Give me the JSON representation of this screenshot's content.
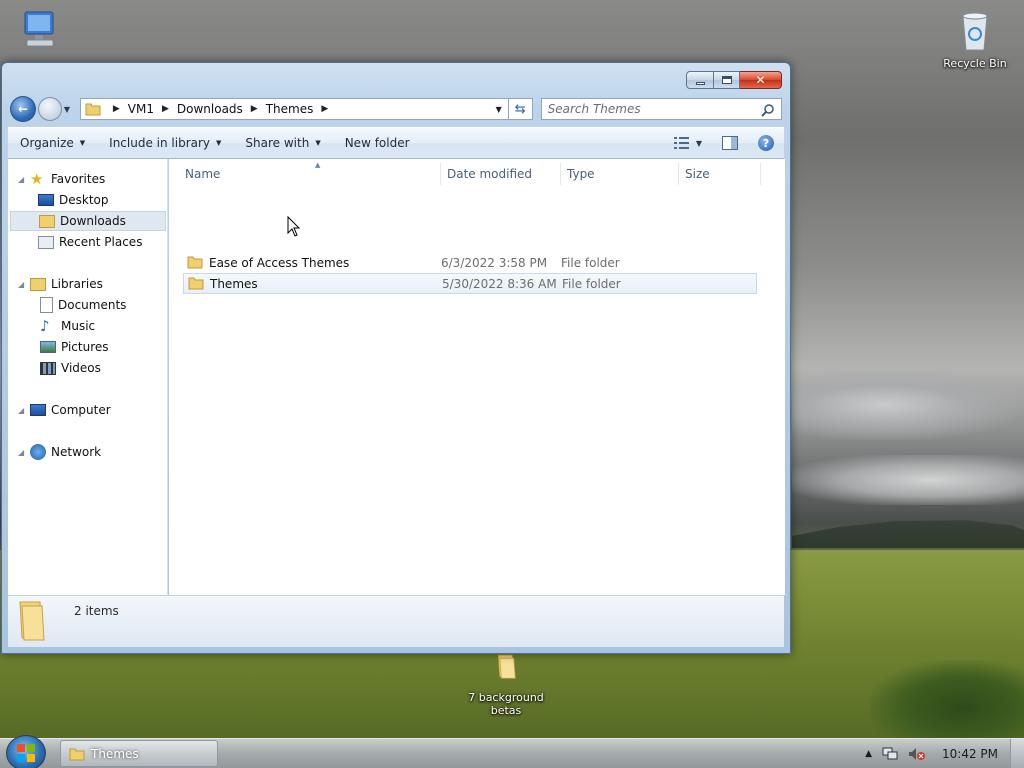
{
  "desktop": {
    "icons": [
      {
        "name": "computer",
        "label": ""
      },
      {
        "name": "recycle-bin",
        "label": "Recycle Bin"
      },
      {
        "name": "folder",
        "label": "7 background betas"
      }
    ]
  },
  "window": {
    "title": "Themes",
    "controls": [
      "minimize",
      "maximize",
      "close"
    ]
  },
  "address_bar": {
    "breadcrumbs": [
      "VM1",
      "Downloads",
      "Themes"
    ]
  },
  "search": {
    "placeholder": "Search Themes"
  },
  "toolbar": {
    "organize": "Organize",
    "include_in_library": "Include in library",
    "share_with": "Share with",
    "new_folder": "New folder"
  },
  "navigation": {
    "favorites": "Favorites",
    "desktop": "Desktop",
    "downloads": "Downloads",
    "recent_places": "Recent Places",
    "libraries": "Libraries",
    "documents": "Documents",
    "music": "Music",
    "pictures": "Pictures",
    "videos": "Videos",
    "computer": "Computer",
    "network": "Network",
    "selected": "Downloads"
  },
  "file_list": {
    "columns": {
      "name": "Name",
      "date": "Date modified",
      "type": "Type",
      "size": "Size"
    },
    "rows": [
      {
        "name": "Ease of Access Themes",
        "date": "6/3/2022 3:58 PM",
        "type": "File folder",
        "size": ""
      },
      {
        "name": "Themes",
        "date": "5/30/2022 8:36 AM",
        "type": "File folder",
        "size": ""
      }
    ]
  },
  "details": {
    "item_count": "2 items"
  },
  "taskbar": {
    "active_window": "Themes",
    "clock": "10:42 PM"
  },
  "colors": {
    "accent": "#2f6cb8",
    "selection": "#dfe7f1",
    "close_button": "#d9472b"
  }
}
